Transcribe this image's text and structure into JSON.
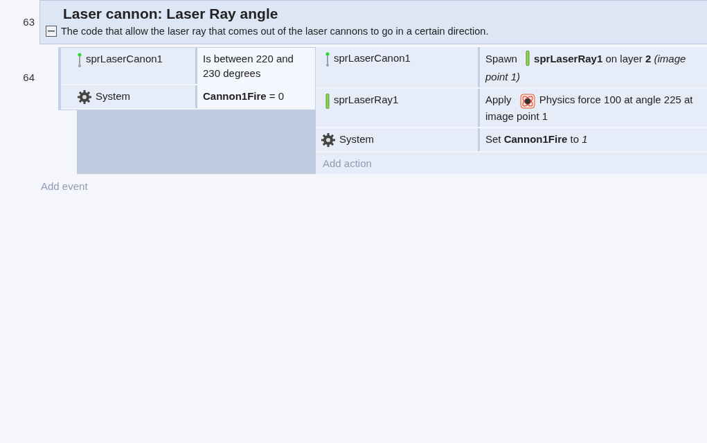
{
  "line_numbers": [
    "63",
    "64"
  ],
  "group": {
    "title": "Laser cannon: Laser Ray angle",
    "description": "The code that allow the laser ray that comes out of the laser cannons to go in a certain direction.",
    "expanded": true
  },
  "conditions": [
    {
      "object": "sprLaserCanon1",
      "object_icon": {
        "kind": "canon"
      },
      "text": "Is between 220 and 230 degrees"
    },
    {
      "object": "System",
      "object_icon": {
        "kind": "system"
      },
      "text": "**Cannon1Fire** = 0"
    }
  ],
  "actions": [
    {
      "object": "sprLaserCanon1",
      "object_icon": {
        "kind": "canon"
      },
      "before": "Spawn",
      "inline_icon": {
        "kind": "ray"
      },
      "after": "**sprLaserRay1** on layer **2** *(image point 1)*"
    },
    {
      "object": "sprLaserRay1",
      "object_icon": {
        "kind": "ray"
      },
      "before": "Apply",
      "inline_icon": {
        "kind": "physics"
      },
      "after": "Physics force 100 at angle 225 at image point 1"
    },
    {
      "object": "System",
      "object_icon": {
        "kind": "system"
      },
      "before": "Set **Cannon1Fire** to *1*"
    }
  ],
  "add_action": "Add action",
  "add_event": "Add event"
}
